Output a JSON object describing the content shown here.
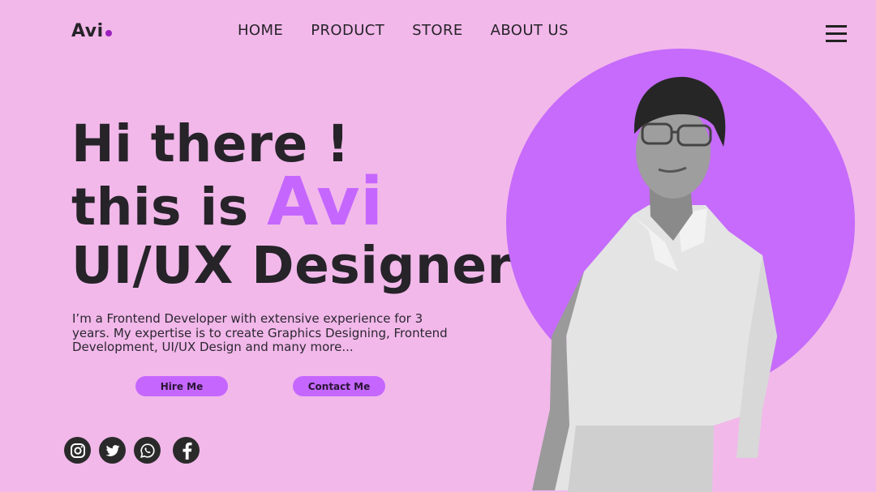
{
  "header": {
    "logo": "Avi",
    "nav": [
      "HOME",
      "PRODUCT",
      "STORE",
      "ABOUT US"
    ]
  },
  "hero": {
    "line1": "Hi there !",
    "line2_prefix": "this is ",
    "line2_name": "Avi",
    "line3": "UI/UX Designer",
    "bio": "I’m a Frontend Developer with extensive experience for 3 years. My expertise is to create Graphics Designing, Frontend Development, UI/UX Design and many more...",
    "buttons": {
      "hire": "Hire Me",
      "contact": "Contact Me"
    }
  },
  "socials": [
    "instagram-icon",
    "twitter-icon",
    "whatsapp-icon",
    "facebook-icon"
  ],
  "colors": {
    "background": "#f2b8ea",
    "accent": "#c567ff",
    "circle": "#c66bfb",
    "text": "#262329"
  }
}
